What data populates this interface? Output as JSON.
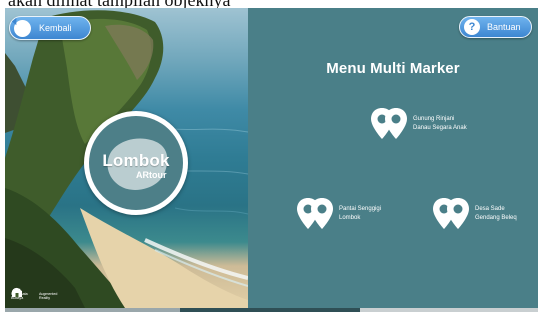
{
  "caption": "akan dilihat tampilan objeknya",
  "header": {
    "back_label": "Kembali",
    "help_label": "Bantuan",
    "help_glyph": "?"
  },
  "logo": {
    "title": "Lombok",
    "subtitle": "ARtour"
  },
  "menu": {
    "title": "Menu Multi Marker",
    "markers": [
      {
        "line1": "Gunung Rinjani",
        "line2": "Danau Segara Anak"
      },
      {
        "line1": "Pantai Senggigi",
        "line2": "Lombok"
      },
      {
        "line1": "Desa Sade",
        "line2": "Gendang Beleq"
      }
    ]
  },
  "footer": {
    "items": [
      {
        "icon": "no-symbol-icon",
        "label": "Pariwisata Budaya"
      },
      {
        "icon": "augmented-reality-icon",
        "label": "Augmented Reality"
      }
    ]
  },
  "colors": {
    "panel": "#4a7f88",
    "button": "#3d86d1",
    "text": "#ffffff"
  }
}
